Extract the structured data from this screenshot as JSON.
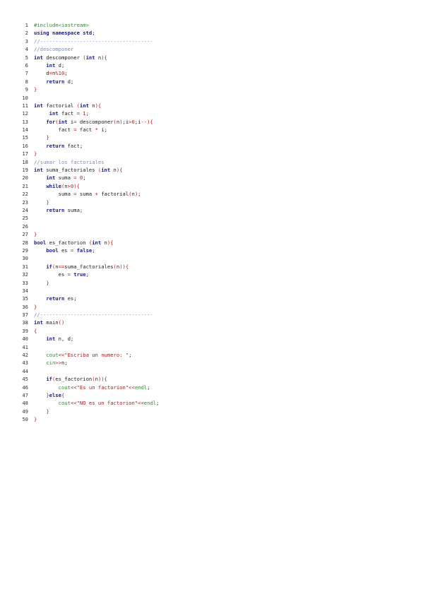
{
  "document": {
    "lines": [
      {
        "n": "1",
        "t": [
          [
            "pp",
            "#include<iostream>"
          ]
        ]
      },
      {
        "n": "2",
        "t": [
          [
            "kw",
            "using namespace"
          ],
          [
            "plain",
            " "
          ],
          [
            "kw",
            "std"
          ],
          [
            "plain",
            ";"
          ]
        ]
      },
      {
        "n": "3",
        "t": [
          [
            "cm",
            "//-------------------------------------"
          ]
        ]
      },
      {
        "n": "4",
        "t": [
          [
            "cm",
            "//descomponer"
          ]
        ]
      },
      {
        "n": "5",
        "t": [
          [
            "kw",
            "int"
          ],
          [
            "plain",
            " descomponer "
          ],
          [
            "br",
            "("
          ],
          [
            "kw",
            "int"
          ],
          [
            "plain",
            " n"
          ],
          [
            "br",
            "){"
          ]
        ]
      },
      {
        "n": "6",
        "t": [
          [
            "plain",
            "    "
          ],
          [
            "kw",
            "int"
          ],
          [
            "plain",
            " d;"
          ]
        ]
      },
      {
        "n": "7",
        "t": [
          [
            "plain",
            "    d"
          ],
          [
            "op",
            "="
          ],
          [
            "plain",
            "n"
          ],
          [
            "op",
            "%"
          ],
          [
            "num",
            "10"
          ],
          [
            "plain",
            ";"
          ]
        ]
      },
      {
        "n": "8",
        "t": [
          [
            "plain",
            "    "
          ],
          [
            "kw",
            "return"
          ],
          [
            "plain",
            " d;"
          ]
        ]
      },
      {
        "n": "9",
        "t": [
          [
            "br",
            "}"
          ]
        ]
      },
      {
        "n": "10",
        "t": [
          [
            "plain",
            ""
          ]
        ]
      },
      {
        "n": "11",
        "t": [
          [
            "kw",
            "int"
          ],
          [
            "plain",
            " factorial "
          ],
          [
            "br",
            "("
          ],
          [
            "kw",
            "int"
          ],
          [
            "plain",
            " n"
          ],
          [
            "br",
            "){"
          ]
        ]
      },
      {
        "n": "12",
        "t": [
          [
            "plain",
            "     "
          ],
          [
            "kw",
            "int"
          ],
          [
            "plain",
            " fact "
          ],
          [
            "op",
            "="
          ],
          [
            "plain",
            " "
          ],
          [
            "num",
            "1"
          ],
          [
            "plain",
            ";"
          ]
        ]
      },
      {
        "n": "13",
        "t": [
          [
            "plain",
            "    "
          ],
          [
            "kw",
            "for"
          ],
          [
            "br",
            "("
          ],
          [
            "kw",
            "int"
          ],
          [
            "plain",
            " i"
          ],
          [
            "op",
            "="
          ],
          [
            "plain",
            " descomponer"
          ],
          [
            "br",
            "("
          ],
          [
            "plain",
            "n"
          ],
          [
            "br",
            ")"
          ],
          [
            "plain",
            ";i"
          ],
          [
            "op",
            ">"
          ],
          [
            "num",
            "0"
          ],
          [
            "plain",
            ";i"
          ],
          [
            "op",
            "--"
          ],
          [
            "br",
            "){"
          ]
        ]
      },
      {
        "n": "14",
        "t": [
          [
            "plain",
            "        fact "
          ],
          [
            "op",
            "="
          ],
          [
            "plain",
            " fact "
          ],
          [
            "op",
            "*"
          ],
          [
            "plain",
            " i;"
          ]
        ]
      },
      {
        "n": "15",
        "t": [
          [
            "plain",
            "    "
          ],
          [
            "br",
            "}"
          ]
        ]
      },
      {
        "n": "16",
        "t": [
          [
            "plain",
            "    "
          ],
          [
            "kw",
            "return"
          ],
          [
            "plain",
            " fact;"
          ]
        ]
      },
      {
        "n": "17",
        "t": [
          [
            "br",
            "}"
          ]
        ]
      },
      {
        "n": "18",
        "t": [
          [
            "cm",
            "//sumar los factoriales"
          ]
        ]
      },
      {
        "n": "19",
        "t": [
          [
            "kw",
            "int"
          ],
          [
            "plain",
            " suma_factoriales "
          ],
          [
            "br",
            "("
          ],
          [
            "kw",
            "int"
          ],
          [
            "plain",
            " n"
          ],
          [
            "br",
            "){"
          ]
        ]
      },
      {
        "n": "20",
        "t": [
          [
            "plain",
            "    "
          ],
          [
            "kw",
            "int"
          ],
          [
            "plain",
            " suma "
          ],
          [
            "op",
            "="
          ],
          [
            "plain",
            " "
          ],
          [
            "num",
            "0"
          ],
          [
            "plain",
            ";"
          ]
        ]
      },
      {
        "n": "21",
        "t": [
          [
            "plain",
            "    "
          ],
          [
            "kw",
            "while"
          ],
          [
            "br",
            "("
          ],
          [
            "plain",
            "n"
          ],
          [
            "op",
            ">"
          ],
          [
            "num",
            "0"
          ],
          [
            "br",
            "){"
          ]
        ]
      },
      {
        "n": "22",
        "t": [
          [
            "plain",
            "        suma "
          ],
          [
            "op",
            "="
          ],
          [
            "plain",
            " suma "
          ],
          [
            "op",
            "+"
          ],
          [
            "plain",
            " factorial"
          ],
          [
            "br",
            "("
          ],
          [
            "plain",
            "n"
          ],
          [
            "br",
            ")"
          ],
          [
            "plain",
            ";"
          ]
        ]
      },
      {
        "n": "23",
        "t": [
          [
            "plain",
            "    "
          ],
          [
            "br",
            "}"
          ]
        ]
      },
      {
        "n": "24",
        "t": [
          [
            "plain",
            "    "
          ],
          [
            "kw",
            "return"
          ],
          [
            "plain",
            " suma;"
          ]
        ]
      },
      {
        "n": "25",
        "t": [
          [
            "plain",
            ""
          ]
        ]
      },
      {
        "n": "26",
        "t": [
          [
            "plain",
            ""
          ]
        ]
      },
      {
        "n": "27",
        "t": [
          [
            "br",
            "}"
          ]
        ]
      },
      {
        "n": "28",
        "t": [
          [
            "kw",
            "bool"
          ],
          [
            "plain",
            " es_factorion "
          ],
          [
            "br",
            "("
          ],
          [
            "kw",
            "int"
          ],
          [
            "plain",
            " n"
          ],
          [
            "br",
            "){"
          ]
        ]
      },
      {
        "n": "29",
        "t": [
          [
            "plain",
            "    "
          ],
          [
            "kw",
            "bool"
          ],
          [
            "plain",
            " es "
          ],
          [
            "op",
            "="
          ],
          [
            "plain",
            " "
          ],
          [
            "kw",
            "false"
          ],
          [
            "plain",
            ";"
          ]
        ]
      },
      {
        "n": "30",
        "t": [
          [
            "plain",
            ""
          ]
        ]
      },
      {
        "n": "31",
        "t": [
          [
            "plain",
            "    "
          ],
          [
            "kw",
            "if"
          ],
          [
            "br",
            "("
          ],
          [
            "plain",
            "n"
          ],
          [
            "op",
            "=="
          ],
          [
            "plain",
            "suma_factoriales"
          ],
          [
            "br",
            "("
          ],
          [
            "plain",
            "n"
          ],
          [
            "br",
            ")){"
          ]
        ]
      },
      {
        "n": "32",
        "t": [
          [
            "plain",
            "        es "
          ],
          [
            "op",
            "="
          ],
          [
            "plain",
            " "
          ],
          [
            "kw",
            "true"
          ],
          [
            "plain",
            ";"
          ]
        ]
      },
      {
        "n": "33",
        "t": [
          [
            "plain",
            "    "
          ],
          [
            "br",
            "}"
          ]
        ]
      },
      {
        "n": "34",
        "t": [
          [
            "plain",
            ""
          ]
        ]
      },
      {
        "n": "35",
        "t": [
          [
            "plain",
            "    "
          ],
          [
            "kw",
            "return"
          ],
          [
            "plain",
            " es;"
          ]
        ]
      },
      {
        "n": "36",
        "t": [
          [
            "br",
            "}"
          ]
        ]
      },
      {
        "n": "37",
        "t": [
          [
            "cm",
            "//-------------------------------------"
          ]
        ]
      },
      {
        "n": "38",
        "t": [
          [
            "kw",
            "int"
          ],
          [
            "plain",
            " main"
          ],
          [
            "br",
            "()"
          ]
        ]
      },
      {
        "n": "39",
        "t": [
          [
            "br",
            "{"
          ]
        ]
      },
      {
        "n": "40",
        "t": [
          [
            "plain",
            "    "
          ],
          [
            "kw",
            "int"
          ],
          [
            "plain",
            " n, d;"
          ]
        ]
      },
      {
        "n": "41",
        "t": [
          [
            "plain",
            ""
          ]
        ]
      },
      {
        "n": "42",
        "t": [
          [
            "plain",
            "    "
          ],
          [
            "pp",
            "cout"
          ],
          [
            "op",
            "<<"
          ],
          [
            "str",
            "\"Escriba un numero: \""
          ],
          [
            "plain",
            ";"
          ]
        ]
      },
      {
        "n": "43",
        "t": [
          [
            "plain",
            "    "
          ],
          [
            "pp",
            "cin"
          ],
          [
            "op",
            ">>"
          ],
          [
            "plain",
            "n;"
          ]
        ]
      },
      {
        "n": "44",
        "t": [
          [
            "plain",
            ""
          ]
        ]
      },
      {
        "n": "45",
        "t": [
          [
            "plain",
            "    "
          ],
          [
            "kw",
            "if"
          ],
          [
            "br",
            "("
          ],
          [
            "plain",
            "es_factorion"
          ],
          [
            "br",
            "("
          ],
          [
            "plain",
            "n"
          ],
          [
            "br",
            ")){"
          ]
        ]
      },
      {
        "n": "46",
        "t": [
          [
            "plain",
            "        "
          ],
          [
            "pp",
            "cout"
          ],
          [
            "op",
            "<<"
          ],
          [
            "str",
            "\"Es un factorion\""
          ],
          [
            "op",
            "<<"
          ],
          [
            "pp",
            "endl"
          ],
          [
            "plain",
            ";"
          ]
        ]
      },
      {
        "n": "47",
        "t": [
          [
            "plain",
            "    "
          ],
          [
            "br",
            "}"
          ],
          [
            "kw",
            "else"
          ],
          [
            "br",
            "{"
          ]
        ]
      },
      {
        "n": "48",
        "t": [
          [
            "plain",
            "        "
          ],
          [
            "pp",
            "cout"
          ],
          [
            "op",
            "<<"
          ],
          [
            "str",
            "\"NO es un factorion\""
          ],
          [
            "op",
            "<<"
          ],
          [
            "pp",
            "endl"
          ],
          [
            "plain",
            ";"
          ]
        ]
      },
      {
        "n": "49",
        "t": [
          [
            "plain",
            "    "
          ],
          [
            "br",
            "}"
          ]
        ]
      },
      {
        "n": "50",
        "t": [
          [
            "br",
            "}"
          ]
        ]
      }
    ]
  }
}
